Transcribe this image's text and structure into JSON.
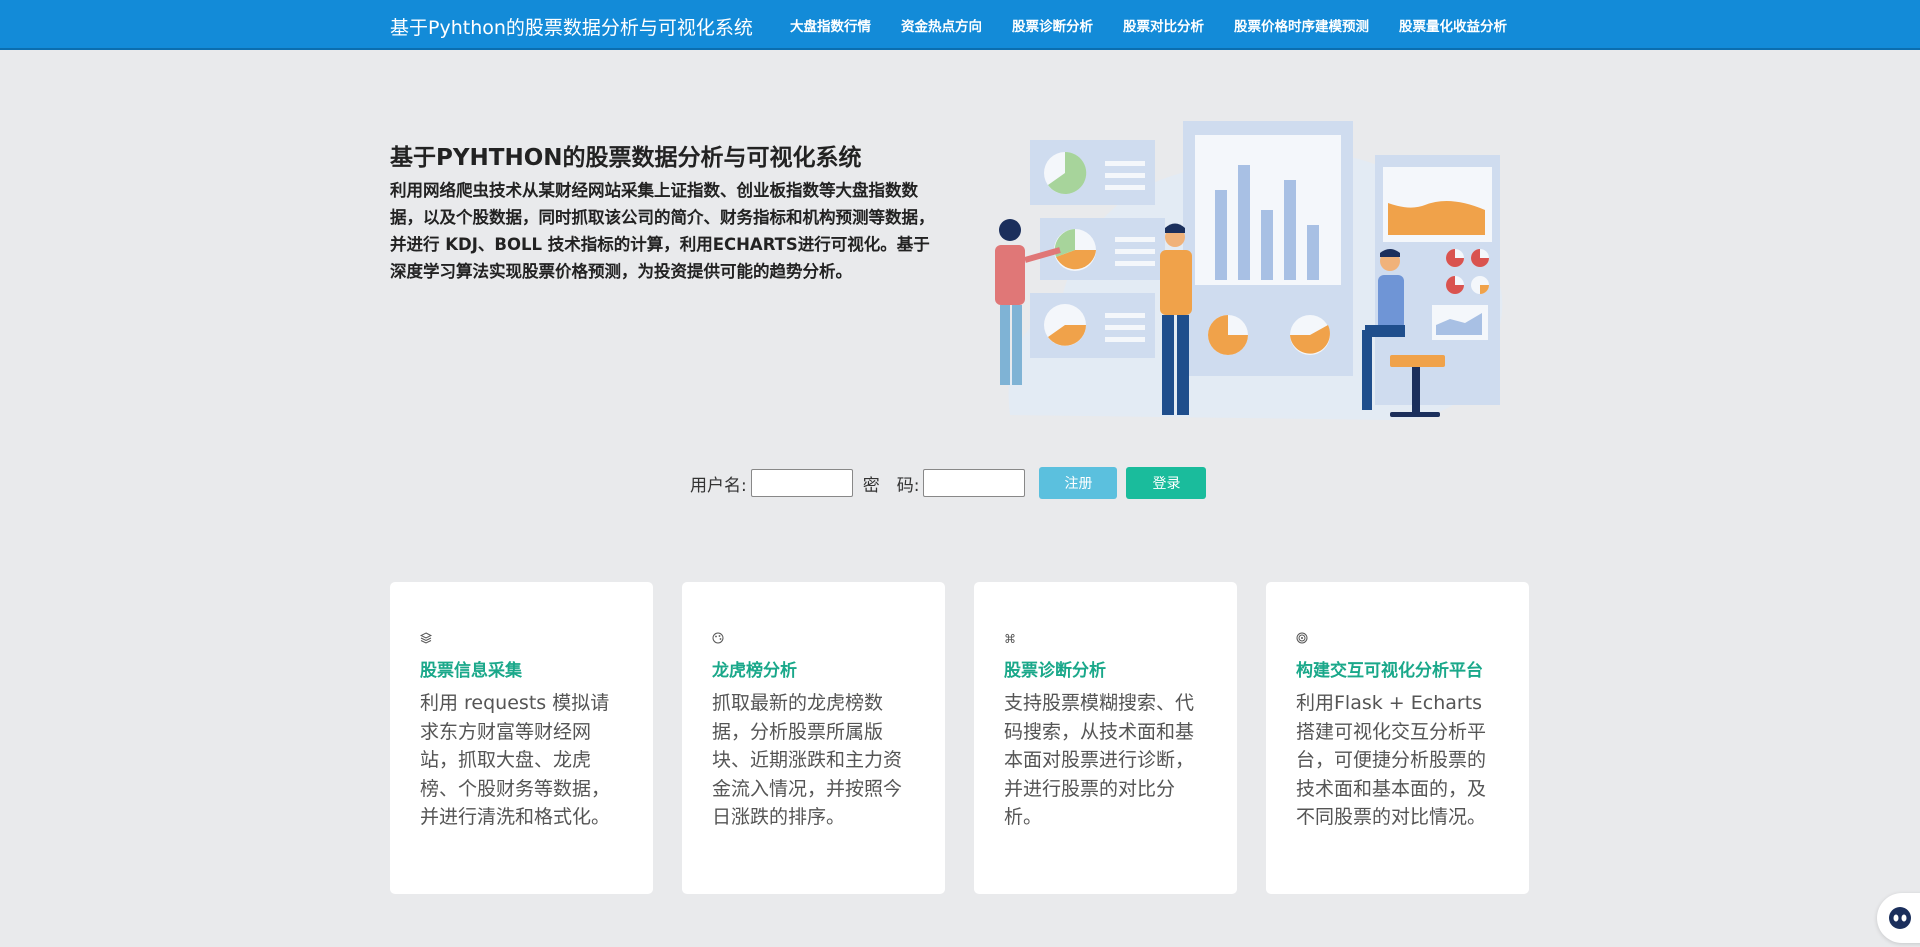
{
  "navbar": {
    "brand": "基于Pyhthon的股票数据分析与可视化系统",
    "items": [
      "大盘指数行情",
      "资金热点方向",
      "股票诊断分析",
      "股票对比分析",
      "股票价格时序建模预测",
      "股票量化收益分析"
    ]
  },
  "hero": {
    "title": "基于PYHTHON的股票数据分析与可视化系统",
    "description": "利用网络爬虫技术从某财经网站采集上证指数、创业板指数等大盘指数数据，以及个股数据，同时抓取该公司的简介、财务指标和机构预测等数据，并进行 KDJ、BOLL 技术指标的计算，利用ECHARTS进行可视化。基于深度学习算法实现股票价格预测，为投资提供可能的趋势分析。"
  },
  "login": {
    "username_label": "用户名:",
    "password_label": "密　码:",
    "username_value": "",
    "password_value": "",
    "register_label": "注册",
    "login_label": "登录"
  },
  "cards": [
    {
      "icon": "layers-icon",
      "title": "股票信息采集",
      "text": "利用 requests 模拟请求东方财富等财经网站，抓取大盘、龙虎榜、个股财务等数据，并进行清洗和格式化。"
    },
    {
      "icon": "palette-icon",
      "title": "龙虎榜分析",
      "text": "抓取最新的龙虎榜数据，分析股票所属版块、近期涨跌和主力资金流入情况，并按照今日涨跌的排序。"
    },
    {
      "icon": "command-icon",
      "title": "股票诊断分析",
      "text": "支持股票模糊搜索、代码搜索，从技术面和基本面对股票进行诊断，并进行股票的对比分析。"
    },
    {
      "icon": "fingerprint-icon",
      "title": "构建交互可视化分析平台",
      "text": "利用Flask + Echarts搭建可视化交互分析平台，可便捷分析股票的技术面和基本面的，及不同股票的对比情况。"
    }
  ],
  "colors": {
    "navbar": "#138bd8",
    "accent": "#1aa88a",
    "register": "#5bc0de",
    "login": "#1abc9c"
  }
}
